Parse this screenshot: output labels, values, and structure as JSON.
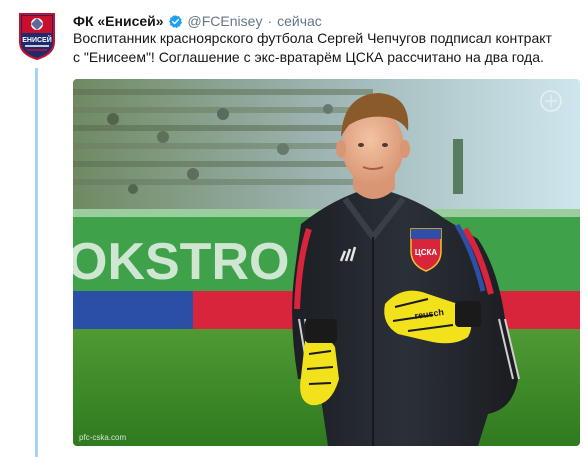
{
  "tweet": {
    "author_name": "ФК «Енисей»",
    "handle": "@FCEnisey",
    "separator": "·",
    "time": "сейчас",
    "text_line1": "Воспитанник красноярского футбола Сергей Чепчугов подписал контракт",
    "text_line2": "с \"Енисеем\"! Соглашение с экс-вратарём ЦСКА рассчитано на два года."
  },
  "avatar": {
    "logo_text": "ЕНИСЕЙ",
    "colors": {
      "red": "#c8102e",
      "navy": "#1d2a6b",
      "white": "#ffffff"
    }
  },
  "media": {
    "board_text": "OKSTRO",
    "crest_text": "ЦСКА",
    "glove_brand": "reusch",
    "watermark": "pfc-cska.com"
  },
  "colors": {
    "verified_blue": "#1da1f2",
    "thread_line": "#a3d4f2",
    "secondary_text": "#657786",
    "pitch_green": "#3d8a2a",
    "glove_yellow": "#f2e21c"
  }
}
